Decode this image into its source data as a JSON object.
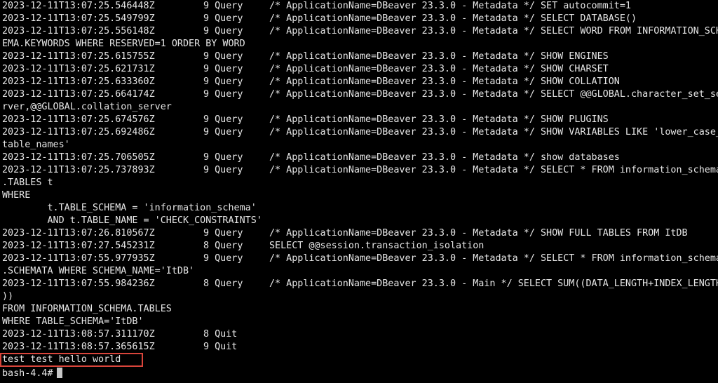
{
  "terminal": {
    "lines": [
      {
        "ts": "2023-12-11T13:07:25.546448Z",
        "cmd": "9 Query",
        "arg": "/* ApplicationName=DBeaver 23.3.0 - Metadata */ SET autocommit=1"
      },
      {
        "ts": "2023-12-11T13:07:25.549799Z",
        "cmd": "9 Query",
        "arg": "/* ApplicationName=DBeaver 23.3.0 - Metadata */ SELECT DATABASE()"
      },
      {
        "ts": "2023-12-11T13:07:25.556148Z",
        "cmd": "9 Query",
        "arg": "/* ApplicationName=DBeaver 23.3.0 - Metadata */ SELECT WORD FROM INFORMATION_SCH"
      },
      {
        "text": "EMA.KEYWORDS WHERE RESERVED=1 ORDER BY WORD"
      },
      {
        "ts": "2023-12-11T13:07:25.615755Z",
        "cmd": "9 Query",
        "arg": "/* ApplicationName=DBeaver 23.3.0 - Metadata */ SHOW ENGINES"
      },
      {
        "ts": "2023-12-11T13:07:25.621731Z",
        "cmd": "9 Query",
        "arg": "/* ApplicationName=DBeaver 23.3.0 - Metadata */ SHOW CHARSET"
      },
      {
        "ts": "2023-12-11T13:07:25.633360Z",
        "cmd": "9 Query",
        "arg": "/* ApplicationName=DBeaver 23.3.0 - Metadata */ SHOW COLLATION"
      },
      {
        "ts": "2023-12-11T13:07:25.664174Z",
        "cmd": "9 Query",
        "arg": "/* ApplicationName=DBeaver 23.3.0 - Metadata */ SELECT @@GLOBAL.character_set_se"
      },
      {
        "text": "rver,@@GLOBAL.collation_server"
      },
      {
        "ts": "2023-12-11T13:07:25.674576Z",
        "cmd": "9 Query",
        "arg": "/* ApplicationName=DBeaver 23.3.0 - Metadata */ SHOW PLUGINS"
      },
      {
        "ts": "2023-12-11T13:07:25.692486Z",
        "cmd": "9 Query",
        "arg": "/* ApplicationName=DBeaver 23.3.0 - Metadata */ SHOW VARIABLES LIKE 'lower_case_"
      },
      {
        "text": "table_names'"
      },
      {
        "ts": "2023-12-11T13:07:25.706505Z",
        "cmd": "9 Query",
        "arg": "/* ApplicationName=DBeaver 23.3.0 - Metadata */ show databases"
      },
      {
        "ts": "2023-12-11T13:07:25.737893Z",
        "cmd": "9 Query",
        "arg": "/* ApplicationName=DBeaver 23.3.0 - Metadata */ SELECT * FROM information_schema"
      },
      {
        "text": ".TABLES t"
      },
      {
        "text": "WHERE"
      },
      {
        "text": "        t.TABLE_SCHEMA = 'information_schema'"
      },
      {
        "text": "        AND t.TABLE_NAME = 'CHECK_CONSTRAINTS'"
      },
      {
        "ts": "2023-12-11T13:07:26.810567Z",
        "cmd": "9 Query",
        "arg": "/* ApplicationName=DBeaver 23.3.0 - Metadata */ SHOW FULL TABLES FROM ItDB"
      },
      {
        "ts": "2023-12-11T13:07:27.545231Z",
        "cmd": "8 Query",
        "arg": "SELECT @@session.transaction_isolation"
      },
      {
        "ts": "2023-12-11T13:07:55.977935Z",
        "cmd": "9 Query",
        "arg": "/* ApplicationName=DBeaver 23.3.0 - Metadata */ SELECT * FROM information_schema"
      },
      {
        "text": ".SCHEMATA WHERE SCHEMA_NAME='ItDB'"
      },
      {
        "ts": "2023-12-11T13:07:55.984236Z",
        "cmd": "8 Query",
        "arg": "/* ApplicationName=DBeaver 23.3.0 - Main */ SELECT SUM((DATA_LENGTH+INDEX_LENGTH"
      },
      {
        "text": "))"
      },
      {
        "text": "FROM INFORMATION_SCHEMA.TABLES"
      },
      {
        "text": "WHERE TABLE_SCHEMA='ItDB'"
      },
      {
        "ts": "2023-12-11T13:08:57.311170Z",
        "cmd": "8 Quit",
        "arg": ""
      },
      {
        "ts": "2023-12-11T13:08:57.365615Z",
        "cmd": "9 Quit",
        "arg": ""
      },
      {
        "text": "test test hello world"
      }
    ],
    "prompt": "bash-4.4#",
    "highlight_color": "#d9453b",
    "background_color": "#000000",
    "text_color": "#e6e6e6"
  }
}
